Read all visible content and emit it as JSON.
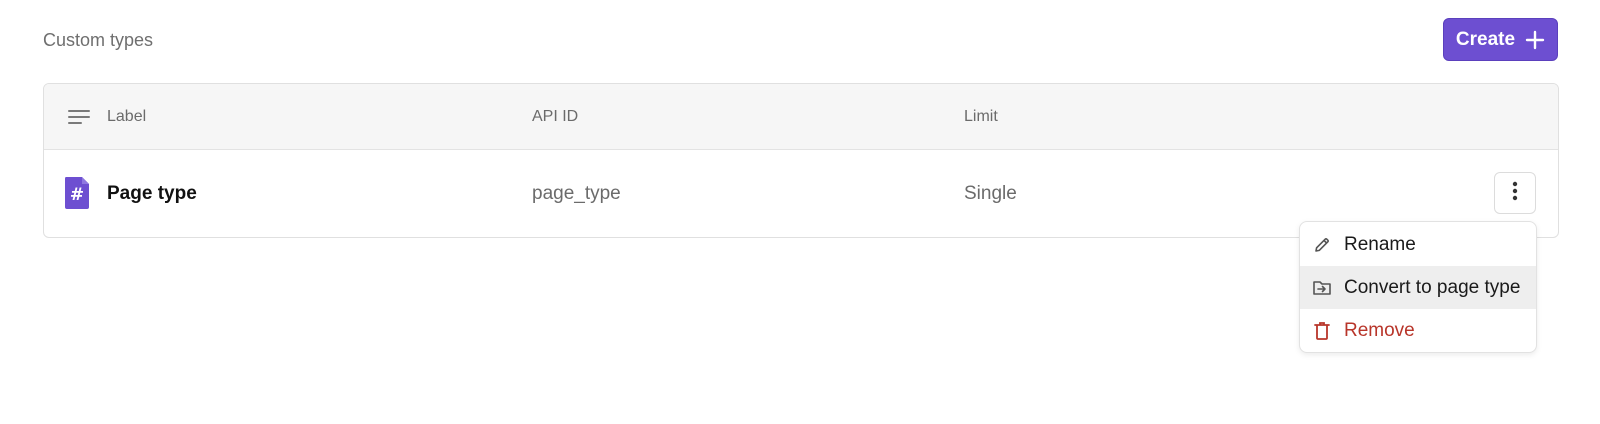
{
  "page": {
    "title": "Custom types"
  },
  "toolbar": {
    "create_label": "Create",
    "create_icon": "plus-icon",
    "accent_color": "#6d4fd1"
  },
  "table": {
    "columns": [
      {
        "label": "Label"
      },
      {
        "label": "API ID"
      },
      {
        "label": "Limit"
      }
    ],
    "header_icon": "list-icon",
    "rows": [
      {
        "icon": "hash-document-icon",
        "label": "Page type",
        "api_id": "page_type",
        "limit": "Single"
      }
    ]
  },
  "row_actions": {
    "trigger_icon": "more-vertical-icon",
    "items": [
      {
        "label": "Rename",
        "icon": "pencil-icon"
      },
      {
        "label": "Convert to page type",
        "icon": "folder-move-icon",
        "highlighted": true
      },
      {
        "label": "Remove",
        "icon": "trash-icon",
        "danger_color": "#b8352a"
      }
    ]
  }
}
